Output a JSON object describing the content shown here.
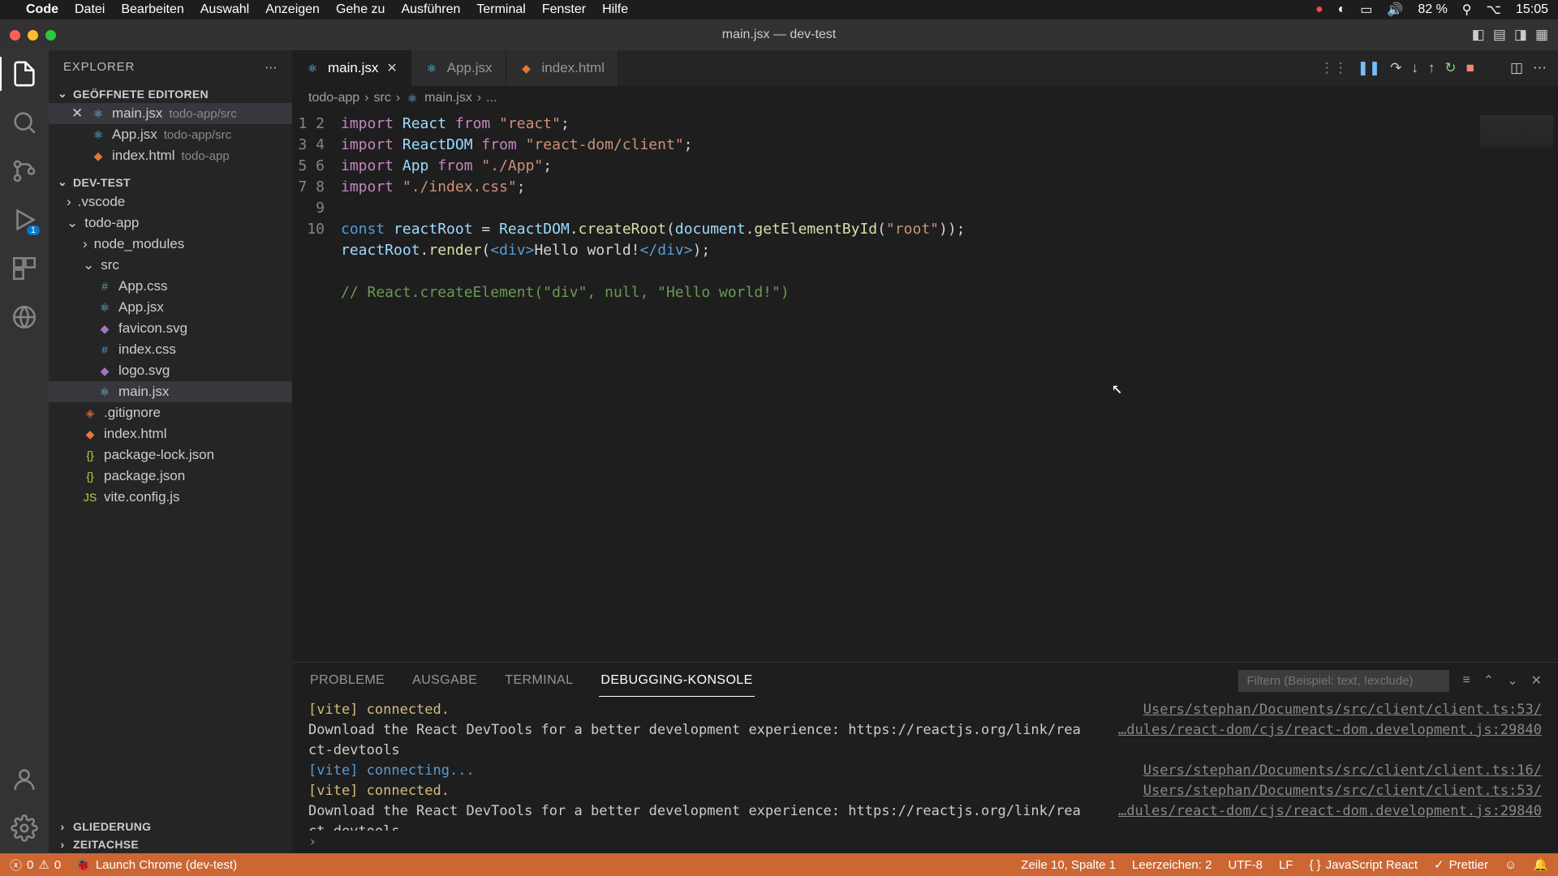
{
  "menubar": {
    "app": "Code",
    "items": [
      "Datei",
      "Bearbeiten",
      "Auswahl",
      "Anzeigen",
      "Gehe zu",
      "Ausführen",
      "Terminal",
      "Fenster",
      "Hilfe"
    ],
    "battery": "82 %",
    "time": "15:05"
  },
  "window": {
    "title": "main.jsx — dev-test"
  },
  "explorer": {
    "title": "EXPLORER",
    "open_editors": "GEÖFFNETE EDITOREN",
    "editors": [
      {
        "name": "main.jsx",
        "hint": "todo-app/src",
        "active": true
      },
      {
        "name": "App.jsx",
        "hint": "todo-app/src",
        "active": false
      },
      {
        "name": "index.html",
        "hint": "todo-app",
        "active": false
      }
    ],
    "project": "DEV-TEST",
    "outline": "GLIEDERUNG",
    "timeline": "ZEITACHSE"
  },
  "tree": {
    "vscode": ".vscode",
    "todo": "todo-app",
    "node_modules": "node_modules",
    "src": "src",
    "files": {
      "appcss": "App.css",
      "appjsx": "App.jsx",
      "favicon": "favicon.svg",
      "indexcss": "index.css",
      "logo": "logo.svg",
      "mainjsx": "main.jsx",
      "gitignore": ".gitignore",
      "indexhtml": "index.html",
      "pkglock": "package-lock.json",
      "pkg": "package.json",
      "vite": "vite.config.js"
    }
  },
  "tabs": [
    {
      "name": "main.jsx",
      "active": true
    },
    {
      "name": "App.jsx",
      "active": false
    },
    {
      "name": "index.html",
      "active": false
    }
  ],
  "breadcrumb": {
    "p1": "todo-app",
    "p2": "src",
    "p3": "main.jsx",
    "p4": "..."
  },
  "code": {
    "l1a": "import ",
    "l1b": "React ",
    "l1c": "from ",
    "l1d": "\"react\"",
    "l1e": ";",
    "l2a": "import ",
    "l2b": "ReactDOM ",
    "l2c": "from ",
    "l2d": "\"react-dom/client\"",
    "l2e": ";",
    "l3a": "import ",
    "l3b": "App ",
    "l3c": "from ",
    "l3d": "\"./App\"",
    "l3e": ";",
    "l4a": "import ",
    "l4b": "\"./index.css\"",
    "l4c": ";",
    "l6a": "const ",
    "l6b": "reactRoot ",
    "l6c": "= ",
    "l6d": "ReactDOM",
    "l6e": ".",
    "l6f": "createRoot",
    "l6g": "(",
    "l6h": "document",
    "l6i": ".",
    "l6j": "getElementById",
    "l6k": "(",
    "l6l": "\"root\"",
    "l6m": "));",
    "l7a": "reactRoot",
    "l7b": ".",
    "l7c": "render",
    "l7d": "(",
    "l7e": "<",
    "l7f": "div",
    "l7g": ">",
    "l7h": "Hello world!",
    "l7i": "</",
    "l7j": "div",
    "l7k": ">",
    "l7l": ");",
    "l9": "// React.createElement(\"div\", null, \"Hello world!\")"
  },
  "panel": {
    "tabs": {
      "problems": "PROBLEME",
      "output": "AUSGABE",
      "terminal": "TERMINAL",
      "debug": "DEBUGGING-KONSOLE"
    },
    "filter_ph": "Filtern (Beispiel: text, !exclude)",
    "lines": [
      {
        "msg": "[vite] connected.",
        "cls": "c-yellow",
        "src": "Users/stephan/Documents/src/client/client.ts:53/"
      },
      {
        "msg": "Download the React DevTools for a better development experience: https://reactjs.org/link/rea",
        "cls": "",
        "src": "…dules/react-dom/cjs/react-dom.development.js:29840"
      },
      {
        "msg": "ct-devtools",
        "cls": "",
        "src": ""
      },
      {
        "msg": "[vite] connecting...",
        "cls": "c-blue",
        "src": "Users/stephan/Documents/src/client/client.ts:16/"
      },
      {
        "msg": "[vite] connected.",
        "cls": "c-yellow",
        "src": "Users/stephan/Documents/src/client/client.ts:53/"
      },
      {
        "msg": "Download the React DevTools for a better development experience: https://reactjs.org/link/rea",
        "cls": "",
        "src": "…dules/react-dom/cjs/react-dom.development.js:29840"
      },
      {
        "msg": "ct-devtools",
        "cls": "",
        "src": ""
      }
    ]
  },
  "status": {
    "errors": "0",
    "warnings": "0",
    "launch": "Launch Chrome (dev-test)",
    "pos": "Zeile 10, Spalte 1",
    "spaces": "Leerzeichen: 2",
    "encoding": "UTF-8",
    "eol": "LF",
    "lang": "JavaScript React",
    "prettier": "Prettier"
  }
}
